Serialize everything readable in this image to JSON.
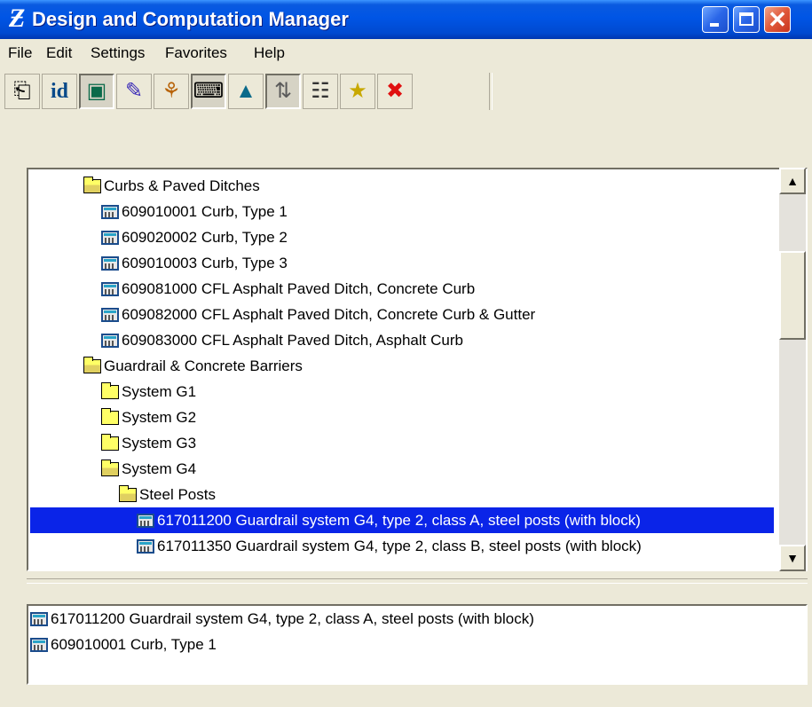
{
  "window": {
    "title": "Design and Computation Manager",
    "app_icon_glyph": "Ƶ",
    "controls": {
      "minimize_icon": "minimize-icon",
      "maximize_icon": "maximize-icon",
      "close_icon": "close-icon",
      "close_glyph": "✕"
    }
  },
  "menu": {
    "file": "File",
    "edit": "Edit",
    "settings": "Settings",
    "favorites": "Favorites",
    "help": "Help"
  },
  "toolbar": {
    "buttons": [
      {
        "icon": "ruler-icon",
        "glyph": "⎗",
        "pressed": false
      },
      {
        "icon": "id-icon",
        "glyph": "id",
        "pressed": false
      },
      {
        "icon": "monitor-icon",
        "glyph": "▣",
        "pressed": true
      },
      {
        "icon": "draw-icon",
        "glyph": "✎",
        "pressed": false
      },
      {
        "icon": "palette-icon",
        "glyph": "⚘",
        "pressed": false
      },
      {
        "icon": "keyboard-icon",
        "glyph": "⌨",
        "pressed": true
      },
      {
        "icon": "shapes-icon",
        "glyph": "▲",
        "pressed": false
      },
      {
        "icon": "arrows-icon",
        "glyph": "⇅",
        "pressed": false
      },
      {
        "icon": "notepad-icon",
        "glyph": "☷",
        "pressed": false
      },
      {
        "icon": "new-folder-icon",
        "glyph": "★",
        "pressed": false
      },
      {
        "icon": "delete-icon",
        "glyph": "✖",
        "pressed": false
      }
    ]
  },
  "tree": {
    "items": [
      {
        "label": "Curbs & Paved Ditches",
        "icon": "folder-open-icon"
      },
      {
        "label": "609010001 Curb, Type 1",
        "icon": "calculator-icon"
      },
      {
        "label": "609020002 Curb, Type 2",
        "icon": "calculator-icon"
      },
      {
        "label": "609010003 Curb, Type 3",
        "icon": "calculator-icon"
      },
      {
        "label": "609081000 CFL Asphalt Paved Ditch, Concrete Curb",
        "icon": "calculator-icon"
      },
      {
        "label": "609082000 CFL Asphalt Paved Ditch, Concrete Curb & Gutter",
        "icon": "calculator-icon"
      },
      {
        "label": "609083000 CFL Asphalt Paved Ditch, Asphalt Curb",
        "icon": "calculator-icon"
      },
      {
        "label": "Guardrail & Concrete Barriers",
        "icon": "folder-open-icon"
      },
      {
        "label": "System G1",
        "icon": "folder-icon"
      },
      {
        "label": "System G2",
        "icon": "folder-icon"
      },
      {
        "label": "System G3",
        "icon": "folder-icon"
      },
      {
        "label": "System G4",
        "icon": "folder-open-icon"
      },
      {
        "label": "Steel Posts",
        "icon": "folder-open-icon"
      },
      {
        "label": "617011200 Guardrail system G4, type 2, class A, steel posts (with block)",
        "icon": "calculator-icon",
        "selected": true
      },
      {
        "label": "617011350 Guardrail system G4, type 2, class B, steel posts (with block)",
        "icon": "calculator-icon"
      }
    ],
    "scrollbar": {
      "up_glyph": "▲",
      "down_glyph": "▼"
    }
  },
  "selection_list": {
    "items": [
      {
        "label": "617011200 Guardrail system G4, type 2, class A, steel posts (with block)",
        "icon": "calculator-icon"
      },
      {
        "label": "609010001 Curb, Type 1",
        "icon": "calculator-icon"
      }
    ]
  },
  "colors": {
    "titlebar": "#0055e5",
    "selection": "#0a24e8",
    "face": "#ece9d8"
  }
}
